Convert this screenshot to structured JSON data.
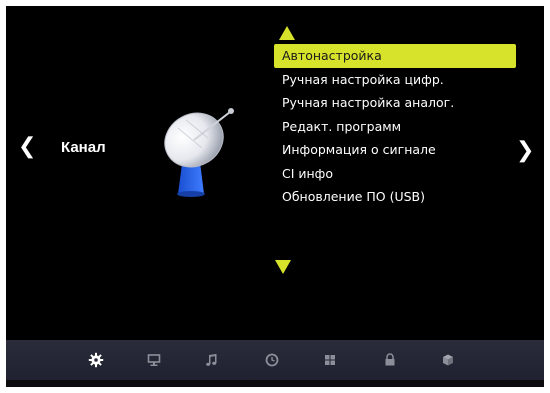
{
  "section": {
    "title": "Канал",
    "prev_arrow": "❮",
    "next_arrow": "❯",
    "icon": "satellite-dish-icon"
  },
  "menu": {
    "selected_index": 0,
    "items": [
      "Автонастройка",
      "Ручная настройка цифр.",
      "Ручная настройка аналог.",
      "Редакт. программ",
      "Информация о сигнале",
      "CI инфо",
      "Обновление ПО (USB)"
    ]
  },
  "tabs": [
    {
      "icon": "gear-icon",
      "active": true
    },
    {
      "icon": "monitor-icon",
      "active": false
    },
    {
      "icon": "music-note-icon",
      "active": false
    },
    {
      "icon": "clock-icon",
      "active": false
    },
    {
      "icon": "grid-icon",
      "active": false
    },
    {
      "icon": "lock-icon",
      "active": false
    },
    {
      "icon": "cube-icon",
      "active": false
    }
  ],
  "colors": {
    "highlight": "#d7e22a",
    "background": "#000000",
    "bar": "#2a2c3a"
  }
}
